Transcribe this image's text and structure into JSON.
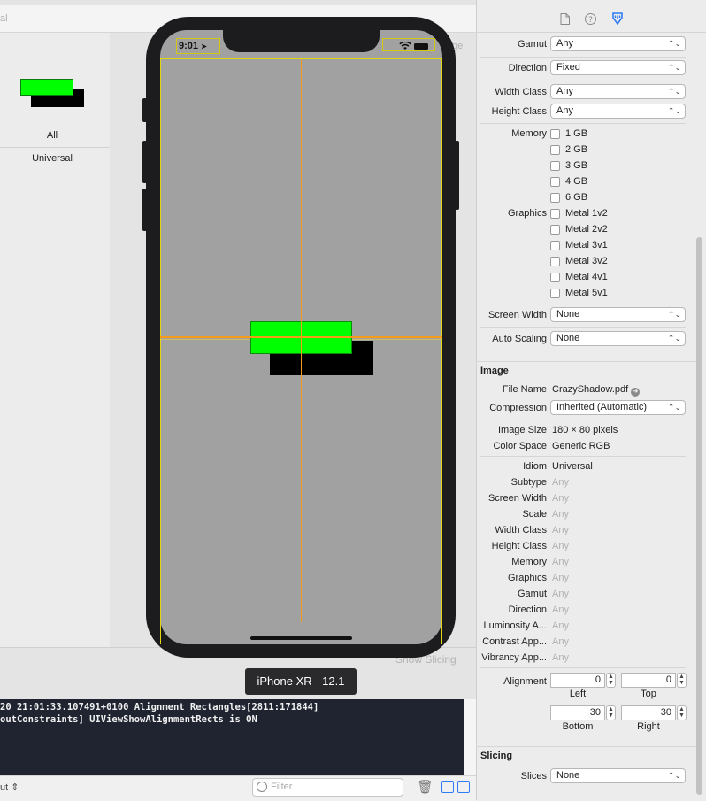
{
  "canvas": {
    "top_bar_text": "al",
    "side_image_text": "ge",
    "asset_labels": {
      "all": "All",
      "universal": "Universal"
    },
    "show_slicing": "Show Slicing",
    "status_time": "9:01",
    "status_arrow": "➤",
    "device_label": "iPhone XR - 12.1"
  },
  "console": {
    "lines": [
      "20 21:01:33.107491+0100 Alignment Rectangles[2811:171844]",
      "outConstraints] UIViewShowAlignmentRects is ON"
    ],
    "output_selector": "ut ⇕",
    "filter_placeholder": "Filter"
  },
  "inspector": {
    "gamut": {
      "label": "Gamut",
      "value": "Any"
    },
    "direction": {
      "label": "Direction",
      "value": "Fixed"
    },
    "width_class": {
      "label": "Width Class",
      "value": "Any"
    },
    "height_class": {
      "label": "Height Class",
      "value": "Any"
    },
    "memory": {
      "label": "Memory",
      "options": [
        "1 GB",
        "2 GB",
        "3 GB",
        "4 GB",
        "6 GB"
      ]
    },
    "graphics": {
      "label": "Graphics",
      "options": [
        "Metal 1v2",
        "Metal 2v2",
        "Metal 3v1",
        "Metal 3v2",
        "Metal 4v1",
        "Metal 5v1"
      ]
    },
    "screen_width": {
      "label": "Screen Width",
      "value": "None"
    },
    "auto_scaling": {
      "label": "Auto Scaling",
      "value": "None"
    },
    "image_section": "Image",
    "file_name": {
      "label": "File Name",
      "value": "CrazyShadow.pdf"
    },
    "compression": {
      "label": "Compression",
      "value": "Inherited (Automatic)"
    },
    "image_size": {
      "label": "Image Size",
      "value": "180 × 80 pixels"
    },
    "color_space": {
      "label": "Color Space",
      "value": "Generic RGB"
    },
    "idiom": {
      "label": "Idiom",
      "value": "Universal"
    },
    "subtype": {
      "label": "Subtype",
      "value": "Any"
    },
    "screen_width2": {
      "label": "Screen Width",
      "value": "Any"
    },
    "scale": {
      "label": "Scale",
      "value": "Any"
    },
    "width_class2": {
      "label": "Width Class",
      "value": "Any"
    },
    "height_class2": {
      "label": "Height Class",
      "value": "Any"
    },
    "memory2": {
      "label": "Memory",
      "value": "Any"
    },
    "graphics2": {
      "label": "Graphics",
      "value": "Any"
    },
    "gamut2": {
      "label": "Gamut",
      "value": "Any"
    },
    "direction2": {
      "label": "Direction",
      "value": "Any"
    },
    "luminosity": {
      "label": "Luminosity A...",
      "value": "Any"
    },
    "contrast": {
      "label": "Contrast App...",
      "value": "Any"
    },
    "vibrancy": {
      "label": "Vibrancy App...",
      "value": "Any"
    },
    "alignment": {
      "label": "Alignment",
      "left": {
        "value": "0",
        "label": "Left"
      },
      "top": {
        "value": "0",
        "label": "Top"
      },
      "bottom": {
        "value": "30",
        "label": "Bottom"
      },
      "right": {
        "value": "30",
        "label": "Right"
      }
    },
    "slicing_section": "Slicing",
    "slices": {
      "label": "Slices",
      "value": "None"
    }
  }
}
